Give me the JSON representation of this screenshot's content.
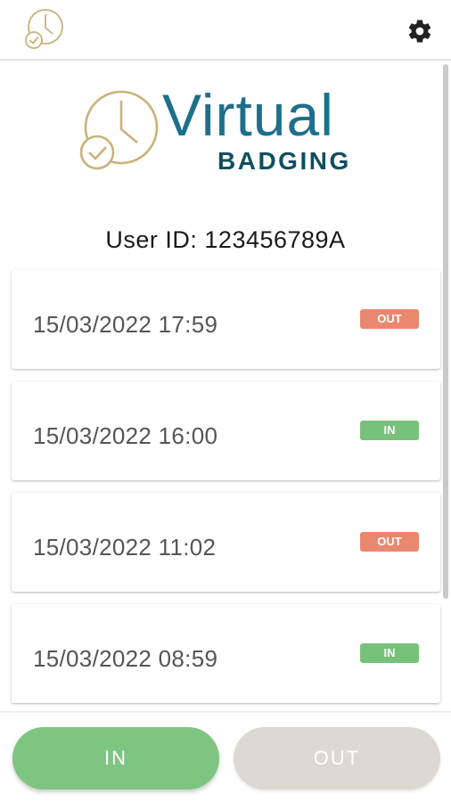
{
  "appbar": {
    "logo_icon": "clock-check-icon",
    "settings_icon": "gear-icon"
  },
  "brand": {
    "virtual": "Virtual",
    "badging": "BADGING",
    "colors": {
      "primary": "#1e6f8c",
      "secondary": "#0f4f5f",
      "icon": "#c9b27a"
    }
  },
  "user": {
    "label": "User ID: 123456789A"
  },
  "entries": [
    {
      "datetime": "15/03/2022 17:59",
      "status": "OUT"
    },
    {
      "datetime": "15/03/2022 16:00",
      "status": "IN"
    },
    {
      "datetime": "15/03/2022 11:02",
      "status": "OUT"
    },
    {
      "datetime": "15/03/2022 08:59",
      "status": "IN"
    }
  ],
  "actions": {
    "in_label": "IN",
    "out_label": "OUT",
    "colors": {
      "in": "#7ec581",
      "out_disabled": "#dcd8d3"
    }
  }
}
